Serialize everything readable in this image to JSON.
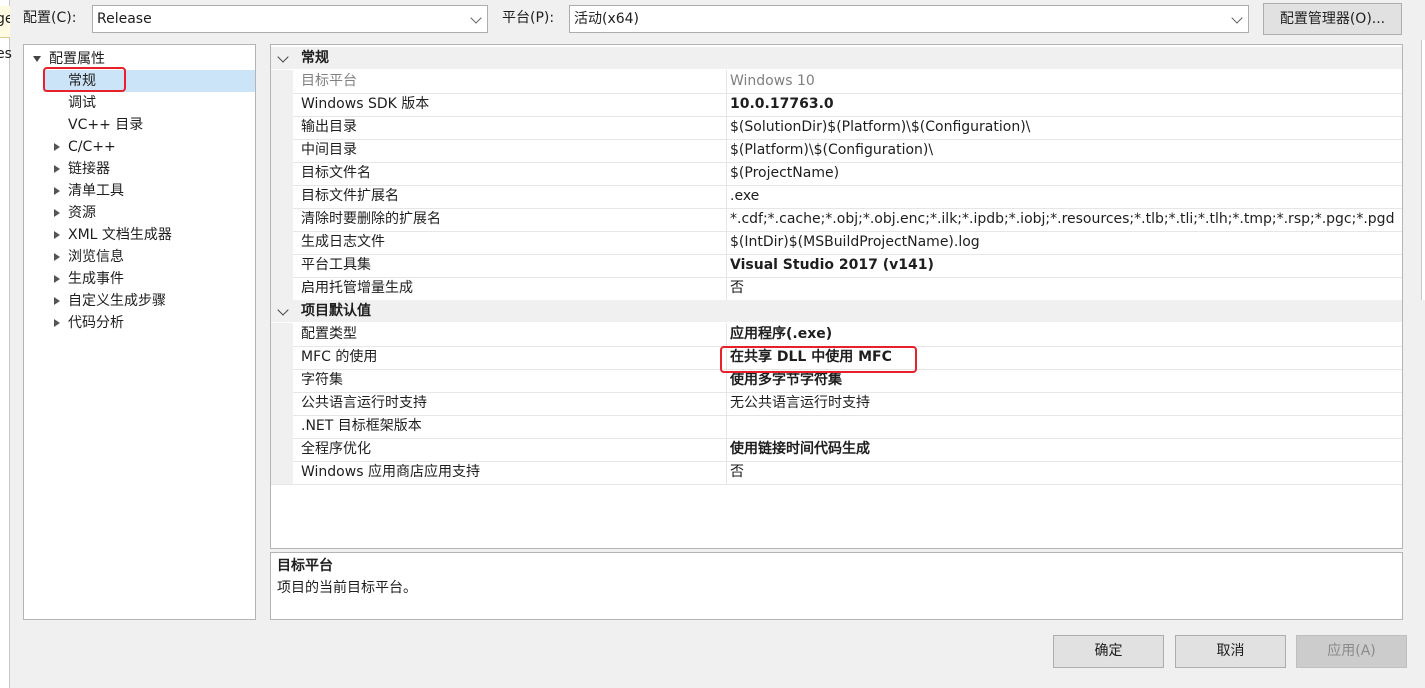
{
  "left_edge": {
    "partial_top": "ge",
    "partial_mid": "es"
  },
  "header": {
    "config_label": "配置(C):",
    "config_value": "Release",
    "platform_label": "平台(P):",
    "platform_value": "活动(x64)",
    "config_manager_label": "配置管理器(O)..."
  },
  "tree": {
    "root": "配置属性",
    "items": [
      {
        "label": "常规",
        "expandable": false,
        "selected": true
      },
      {
        "label": "调试",
        "expandable": false
      },
      {
        "label": "VC++ 目录",
        "expandable": false
      },
      {
        "label": "C/C++",
        "expandable": true
      },
      {
        "label": "链接器",
        "expandable": true
      },
      {
        "label": "清单工具",
        "expandable": true
      },
      {
        "label": "资源",
        "expandable": true
      },
      {
        "label": "XML 文档生成器",
        "expandable": true
      },
      {
        "label": "浏览信息",
        "expandable": true
      },
      {
        "label": "生成事件",
        "expandable": true
      },
      {
        "label": "自定义生成步骤",
        "expandable": true
      },
      {
        "label": "代码分析",
        "expandable": true
      }
    ]
  },
  "grid": {
    "general": {
      "title": "常规",
      "rows": [
        {
          "key": "目标平台",
          "value": "Windows 10"
        },
        {
          "key": "Windows SDK 版本",
          "value": "10.0.17763.0"
        },
        {
          "key": "输出目录",
          "value": "$(SolutionDir)$(Platform)\\$(Configuration)\\"
        },
        {
          "key": "中间目录",
          "value": "$(Platform)\\$(Configuration)\\"
        },
        {
          "key": "目标文件名",
          "value": "$(ProjectName)"
        },
        {
          "key": "目标文件扩展名",
          "value": ".exe"
        },
        {
          "key": "清除时要删除的扩展名",
          "value": "*.cdf;*.cache;*.obj;*.obj.enc;*.ilk;*.ipdb;*.iobj;*.resources;*.tlb;*.tli;*.tlh;*.tmp;*.rsp;*.pgc;*.pgd"
        },
        {
          "key": "生成日志文件",
          "value": "$(IntDir)$(MSBuildProjectName).log"
        },
        {
          "key": "平台工具集",
          "value": "Visual Studio 2017 (v141)"
        },
        {
          "key": "启用托管增量生成",
          "value": "否"
        }
      ]
    },
    "defaults": {
      "title": "项目默认值",
      "rows": [
        {
          "key": "配置类型",
          "value": "应用程序(.exe)"
        },
        {
          "key": "MFC 的使用",
          "value": "在共享 DLL 中使用 MFC"
        },
        {
          "key": "字符集",
          "value": "使用多字节字符集"
        },
        {
          "key": "公共语言运行时支持",
          "value": "无公共语言运行时支持"
        },
        {
          "key": ".NET 目标框架版本",
          "value": ""
        },
        {
          "key": "全程序优化",
          "value": "使用链接时间代码生成"
        },
        {
          "key": "Windows 应用商店应用支持",
          "value": "否"
        }
      ]
    }
  },
  "description": {
    "title": "目标平台",
    "text": "项目的当前目标平台。"
  },
  "footer": {
    "ok_label": "确定",
    "cancel_label": "取消",
    "apply_label": "应用(A)"
  },
  "colors": {
    "highlight": "#e8202a",
    "selection": "#cce4f7"
  }
}
